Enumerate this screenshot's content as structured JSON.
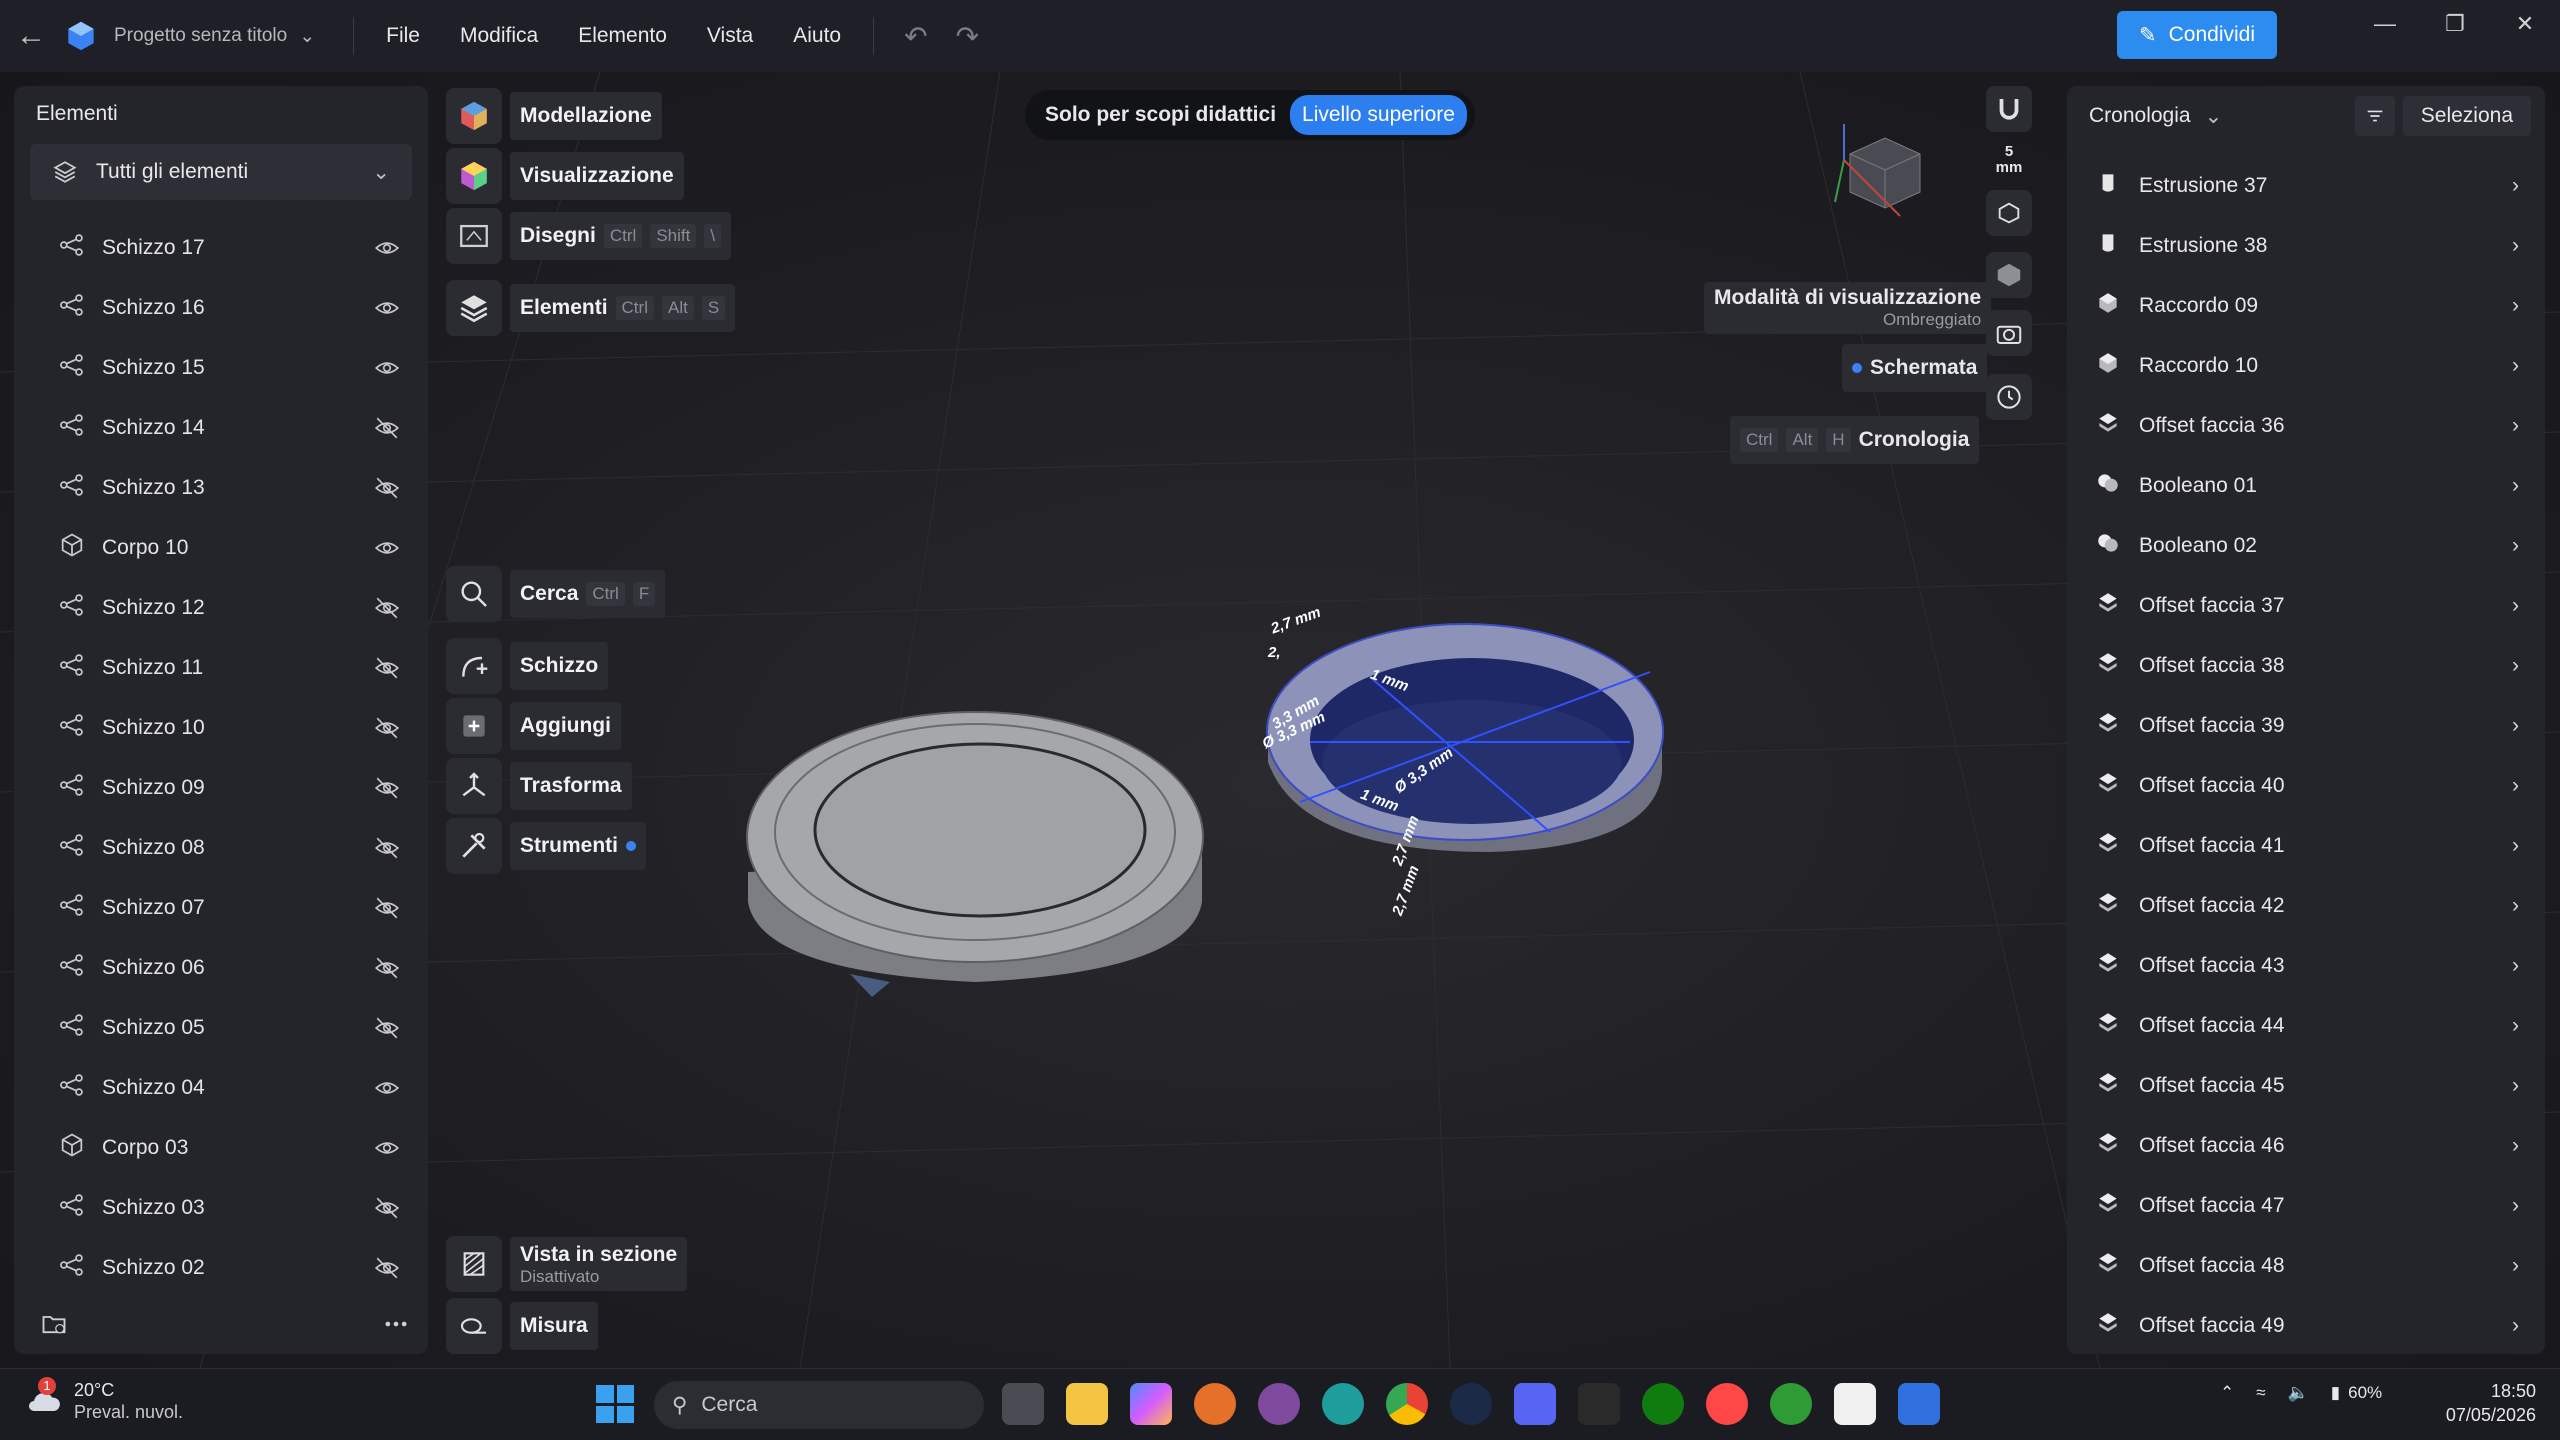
{
  "titlebar": {
    "project_name": "Progetto senza titolo",
    "menu": [
      "File",
      "Modifica",
      "Elemento",
      "Vista",
      "Aiuto"
    ],
    "share_label": "Condividi"
  },
  "elements_panel": {
    "title": "Elementi",
    "filter_value": "Tutti gli elementi",
    "items": [
      {
        "label": "Schizzo 17",
        "type": "sketch",
        "visible": true
      },
      {
        "label": "Schizzo 16",
        "type": "sketch",
        "visible": true
      },
      {
        "label": "Schizzo 15",
        "type": "sketch",
        "visible": true
      },
      {
        "label": "Schizzo 14",
        "type": "sketch",
        "visible": false
      },
      {
        "label": "Schizzo 13",
        "type": "sketch",
        "visible": false
      },
      {
        "label": "Corpo 10",
        "type": "body",
        "visible": true
      },
      {
        "label": "Schizzo 12",
        "type": "sketch",
        "visible": false
      },
      {
        "label": "Schizzo 11",
        "type": "sketch",
        "visible": false
      },
      {
        "label": "Schizzo 10",
        "type": "sketch",
        "visible": false
      },
      {
        "label": "Schizzo 09",
        "type": "sketch",
        "visible": false
      },
      {
        "label": "Schizzo 08",
        "type": "sketch",
        "visible": false
      },
      {
        "label": "Schizzo 07",
        "type": "sketch",
        "visible": false
      },
      {
        "label": "Schizzo 06",
        "type": "sketch",
        "visible": false
      },
      {
        "label": "Schizzo 05",
        "type": "sketch",
        "visible": false
      },
      {
        "label": "Schizzo 04",
        "type": "sketch",
        "visible": true
      },
      {
        "label": "Corpo 03",
        "type": "body",
        "visible": true
      },
      {
        "label": "Schizzo 03",
        "type": "sketch",
        "visible": false
      },
      {
        "label": "Schizzo 02",
        "type": "sketch",
        "visible": false
      }
    ]
  },
  "tools": {
    "modellazione": "Modellazione",
    "visualizzazione": "Visualizzazione",
    "disegni": "Disegni",
    "disegni_keys": [
      "Ctrl",
      "Shift",
      "\\"
    ],
    "elementi": "Elementi",
    "elementi_keys": [
      "Ctrl",
      "Alt",
      "S"
    ],
    "cerca": "Cerca",
    "cerca_keys": [
      "Ctrl",
      "F"
    ],
    "schizzo": "Schizzo",
    "aggiungi": "Aggiungi",
    "trasforma": "Trasforma",
    "strumenti": "Strumenti",
    "vista_sezione": "Vista in sezione",
    "vista_sezione_sub": "Disattivato",
    "misura": "Misura"
  },
  "banner": {
    "text": "Solo per scopi didattici",
    "pill": "Livello superiore"
  },
  "view_controls": {
    "snap_value": "5",
    "snap_unit": "mm",
    "display_mode_title": "Modalità di visualizzazione",
    "display_mode_value": "Ombreggiato",
    "screenshot": "Schermata",
    "history_label": "Cronologia",
    "history_keys": [
      "Ctrl",
      "Alt",
      "H"
    ]
  },
  "dimensions": [
    "2,7 mm",
    "2,",
    "1 mm",
    "3,3 mm",
    "Ø 3,3 mm",
    "Ø 3,3 mm",
    "1 mm",
    "2,7 mm",
    "2,7 mm"
  ],
  "history_panel": {
    "title": "Cronologia",
    "select_label": "Seleziona",
    "items": [
      {
        "label": "Estrusione 37",
        "icon": "extrude-icon"
      },
      {
        "label": "Estrusione 38",
        "icon": "extrude-icon"
      },
      {
        "label": "Raccordo 09",
        "icon": "fillet-icon"
      },
      {
        "label": "Raccordo 10",
        "icon": "fillet-icon"
      },
      {
        "label": "Offset faccia 36",
        "icon": "offset-face-icon"
      },
      {
        "label": "Booleano 01",
        "icon": "boolean-icon"
      },
      {
        "label": "Booleano 02",
        "icon": "boolean-icon"
      },
      {
        "label": "Offset faccia 37",
        "icon": "offset-face-icon"
      },
      {
        "label": "Offset faccia 38",
        "icon": "offset-face-icon"
      },
      {
        "label": "Offset faccia 39",
        "icon": "offset-face-icon"
      },
      {
        "label": "Offset faccia 40",
        "icon": "offset-face-icon"
      },
      {
        "label": "Offset faccia 41",
        "icon": "offset-face-icon"
      },
      {
        "label": "Offset faccia 42",
        "icon": "offset-face-icon"
      },
      {
        "label": "Offset faccia 43",
        "icon": "offset-face-icon"
      },
      {
        "label": "Offset faccia 44",
        "icon": "offset-face-icon"
      },
      {
        "label": "Offset faccia 45",
        "icon": "offset-face-icon"
      },
      {
        "label": "Offset faccia 46",
        "icon": "offset-face-icon"
      },
      {
        "label": "Offset faccia 47",
        "icon": "offset-face-icon"
      },
      {
        "label": "Offset faccia 48",
        "icon": "offset-face-icon"
      },
      {
        "label": "Offset faccia 49",
        "icon": "offset-face-icon"
      }
    ]
  },
  "taskbar": {
    "weather_badge": "1",
    "temperature": "20°C",
    "weather": "Preval. nuvol.",
    "search_placeholder": "Cerca",
    "battery": "60%",
    "time": "18:50",
    "date": "07/05/2026"
  },
  "colors": {
    "accent": "#2d8cf0",
    "panel": "#24252b",
    "background": "#1d1d21"
  }
}
